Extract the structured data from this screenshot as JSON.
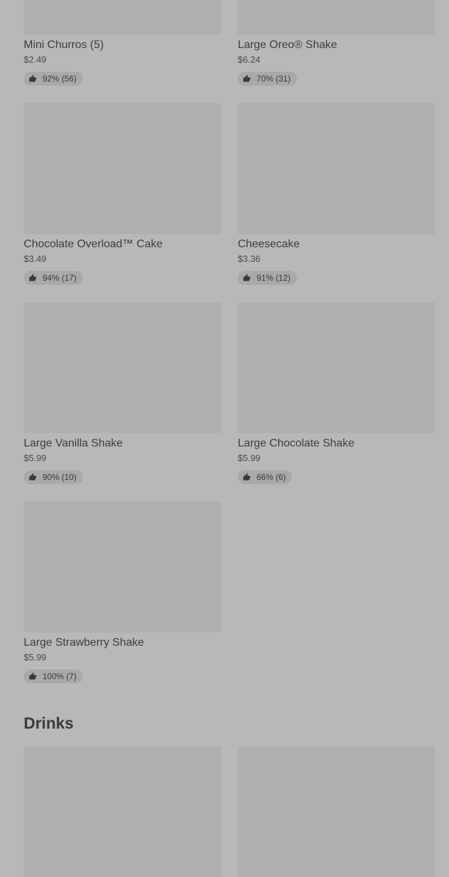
{
  "items": [
    {
      "name": "Mini Churros (5)",
      "price": "$2.49",
      "rating": "92% (56)"
    },
    {
      "name": "Large Oreo® Shake",
      "price": "$6.24",
      "rating": "70% (31)"
    },
    {
      "name": "Chocolate Overload™ Cake",
      "price": "$3.49",
      "rating": "94% (17)"
    },
    {
      "name": "Cheesecake",
      "price": "$3.36",
      "rating": "91% (12)"
    },
    {
      "name": "Large Vanilla Shake",
      "price": "$5.99",
      "rating": "90% (10)"
    },
    {
      "name": "Large Chocolate Shake",
      "price": "$5.99",
      "rating": "66% (6)"
    },
    {
      "name": "Large Strawberry Shake",
      "price": "$5.99",
      "rating": "100% (7)"
    }
  ],
  "drinks_section": {
    "title": "Drinks"
  },
  "icons": {
    "rating": "thumbs-up-icon"
  }
}
